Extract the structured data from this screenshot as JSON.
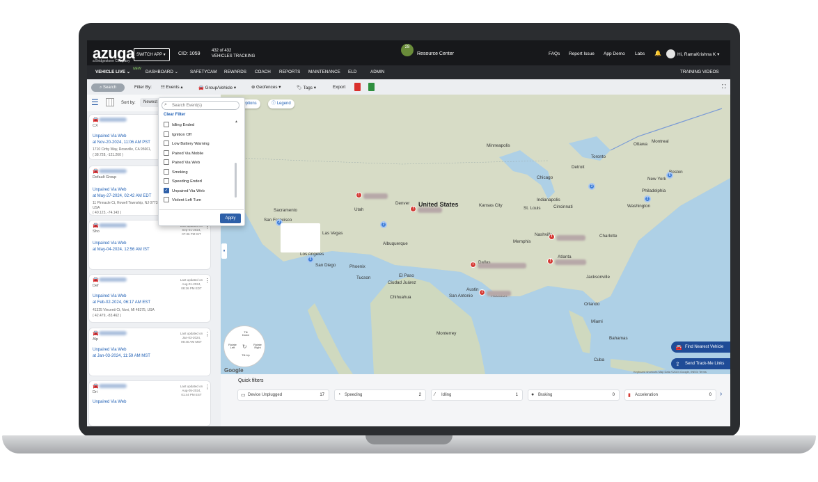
{
  "header": {
    "logo": "azuga",
    "logo_tagline": "a Bridgestone Company",
    "switch_app": "SWITCH APP",
    "cid": "CID: 1059",
    "tracking_count": "432 of 432",
    "tracking_label": "VEHICLES TRACKING",
    "resource_badge": "28",
    "resource_center": "Resource Center",
    "links": [
      "FAQs",
      "Report Issue",
      "App Demo",
      "Labs"
    ],
    "user": "Hi, RamaKrishna K"
  },
  "nav": {
    "items": [
      "VEHICLE LIVE",
      "DASHBOARD",
      "SAFETYCAM",
      "REWARDS",
      "COACH",
      "REPORTS",
      "MAINTENANCE",
      "ELD",
      "ADMIN"
    ],
    "new_badge": "NEW",
    "training": "TRAINING VIDEOS"
  },
  "toolbar": {
    "search": "Search",
    "filter_by": "Filter By:",
    "events": "Events",
    "group_vehicle": "Group/Vehicle",
    "geofences": "Geofences",
    "tags": "Tags",
    "export": "Export"
  },
  "list": {
    "sort_by": "Sort by:",
    "sort_value": "Newest",
    "cards": [
      {
        "sub": "CX",
        "event": "Unpaired Via Web",
        "when": "at Nov-20-2024, 11:06 AM PST",
        "addr1": "1710 Cirby Way, Roseville, CA 95661,",
        "addr2": "( 38.728, -121.260 )",
        "updated": ""
      },
      {
        "sub": "Default Group",
        "event": "Unpaired Via Web",
        "when": "at May-27-2024, 02:42 AM EDT",
        "addr1": "11 Pinnacle Ct, Howell Township, NJ 07731,",
        "addr2": "USA",
        "addr3": "( 40.123, -74.143 )",
        "updated": ""
      },
      {
        "sub": "Sho",
        "event": "Unpaired Via Web",
        "when": "at May-04-2024, 12:56 AM IST",
        "addr1": "",
        "addr2": "",
        "updated": "Last updated on Sep-01-2024, 07:36 PM IST"
      },
      {
        "sub": "Def",
        "event": "Unpaired Via Web",
        "when": "at Feb-02-2024, 06:17 AM EST",
        "addr1": "41325 Vincenti Ct, Novi, MI 48375, USA",
        "addr2": "( 42.479, -83.462 )",
        "updated": "Last updated on Aug-01-2024, 08:26 PM EDT"
      },
      {
        "sub": "Alp",
        "event": "Unpaired Via Web",
        "when": "at Jan-03-2024, 11:59 AM MST",
        "addr1": "",
        "addr2": "",
        "updated": "Last updated on Jan-03-2024, 09:40 AM MST"
      },
      {
        "sub": "Dri",
        "event": "Unpaired Via Web",
        "when": "",
        "addr1": "",
        "addr2": "",
        "updated": "Last updated on Aug-05-2024, 01:44 PM EST"
      }
    ]
  },
  "events_filter": {
    "search_placeholder": "Search Event(s)",
    "clear": "Clear Filter",
    "options": [
      {
        "label": "Idling Ended",
        "checked": false
      },
      {
        "label": "Ignition Off",
        "checked": false
      },
      {
        "label": "Low Battery Warning",
        "checked": false
      },
      {
        "label": "Paired Via Mobile",
        "checked": false
      },
      {
        "label": "Paired Via Web",
        "checked": false
      },
      {
        "label": "Smoking",
        "checked": false
      },
      {
        "label": "Speeding Ended",
        "checked": false
      },
      {
        "label": "Unpaired Via Web",
        "checked": true
      },
      {
        "label": "Violent Left Turn",
        "checked": false
      }
    ],
    "apply": "Apply"
  },
  "map": {
    "options": "Options",
    "legend": "Legend",
    "country": "United States",
    "cities": [
      "Sacramento",
      "San Francisco",
      "Las Vegas",
      "Los Angeles",
      "San Diego",
      "Phoenix",
      "Tucson",
      "Albuquerque",
      "El Paso",
      "Ciudad Juárez",
      "Chihuahua",
      "Monterrey",
      "Denver",
      "Kansas City",
      "St. Louis",
      "Dallas",
      "Austin",
      "San Antonio",
      "Houston",
      "Chicago",
      "Detroit",
      "Indianapolis",
      "Cincinnati",
      "Memphis",
      "Atlanta",
      "Charlotte",
      "Washington",
      "Philadelphia",
      "New York",
      "Boston",
      "Toronto",
      "Ottawa",
      "Montreal",
      "Jacksonville",
      "Miami",
      "Orlando",
      "Bahamas",
      "Cuba",
      "Minneapolis",
      "Utah",
      "Nashville"
    ],
    "cluster_counts": [
      "2",
      "2",
      "5",
      "3",
      "6",
      "2"
    ],
    "compass": {
      "tilt_down": "Tilt Down",
      "tilt_up": "Tilt Up",
      "rotate_left": "Rotate Left",
      "rotate_right": "Rotate Right"
    },
    "find_nearest": "Find Nearest Vehicle",
    "send_track": "Send Track-Me Links",
    "google": "Google",
    "attribution": "Keyboard shortcuts   Map Data ©2024 Google, INEGI   Terms"
  },
  "quick_filters": {
    "title": "Quick filters",
    "items": [
      {
        "label": "Device Unplugged",
        "count": "17"
      },
      {
        "label": "Speeding",
        "count": "2"
      },
      {
        "label": "Idling",
        "count": "1"
      },
      {
        "label": "Braking",
        "count": "0"
      },
      {
        "label": "Acceleration",
        "count": "0"
      }
    ]
  }
}
